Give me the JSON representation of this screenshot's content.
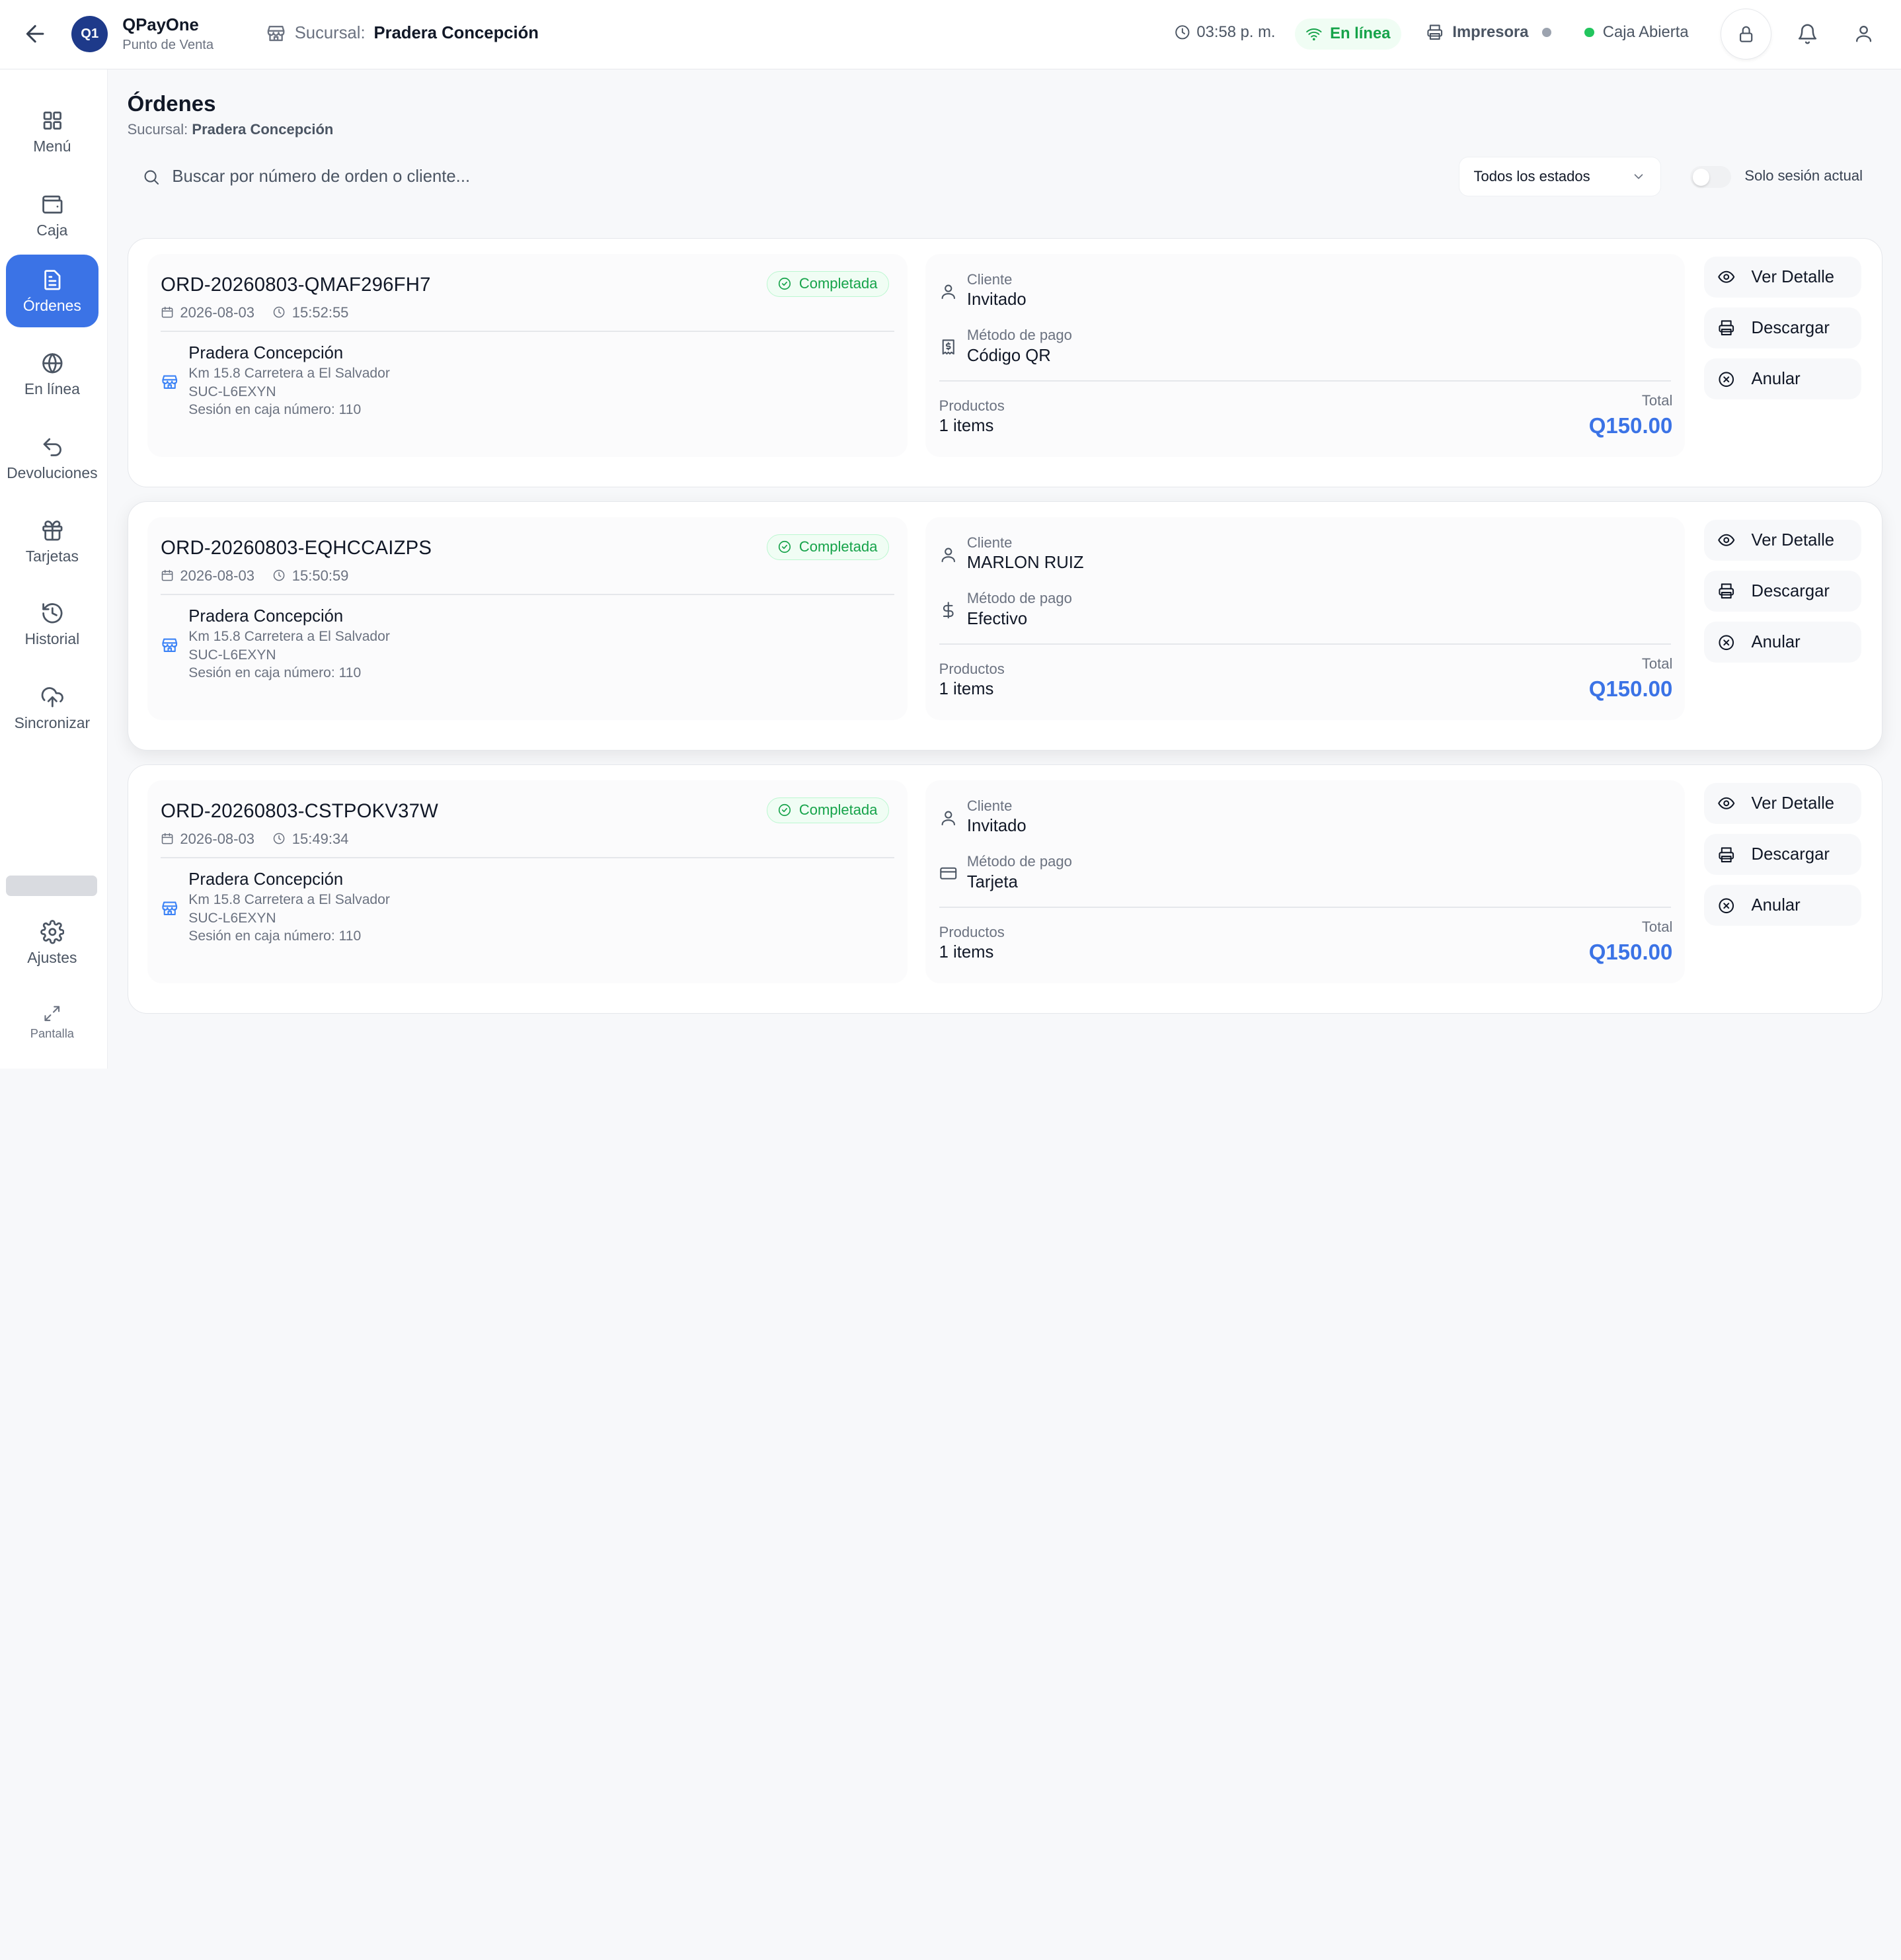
{
  "header": {
    "logo_text": "Q1",
    "app_name": "QPayOne",
    "app_subtitle": "Punto de Venta",
    "branch_label": "Sucursal:",
    "branch_name": "Pradera Concepción",
    "time": "03:58 p. m.",
    "online_label": "En línea",
    "printer_label": "Impresora",
    "register_label": "Caja Abierta"
  },
  "sidebar": {
    "items": [
      {
        "label": "Menú",
        "icon": "grid-icon"
      },
      {
        "label": "Caja",
        "icon": "wallet-icon"
      },
      {
        "label": "Órdenes",
        "icon": "receipt-icon"
      },
      {
        "label": "En línea",
        "icon": "globe-icon"
      },
      {
        "label": "Devoluciones",
        "icon": "undo-icon"
      },
      {
        "label": "Tarjetas",
        "icon": "gift-icon"
      },
      {
        "label": "Historial",
        "icon": "history-icon"
      },
      {
        "label": "Sincronizar",
        "icon": "cloud-upload-icon"
      }
    ],
    "settings_label": "Ajustes",
    "fullscreen_label": "Pantalla",
    "active_index": 2
  },
  "page": {
    "title": "Órdenes",
    "subtitle_label": "Sucursal:",
    "subtitle_value": "Pradera Concepción"
  },
  "filters": {
    "search_placeholder": "Buscar por número de orden o cliente...",
    "search_value": "",
    "status_selected": "Todos los estados",
    "session_toggle_label": "Solo sesión actual",
    "session_toggle_on": false
  },
  "labels": {
    "client": "Cliente",
    "payment": "Método de pago",
    "products": "Productos",
    "total": "Total",
    "view_detail": "Ver Detalle",
    "download": "Descargar",
    "cancel": "Anular"
  },
  "orders": [
    {
      "id": "ORD-20260803-QMAF296FH7",
      "status": "Completada",
      "date": "2026-08-03",
      "time": "15:52:55",
      "store_name": "Pradera Concepción",
      "store_address": "Km 15.8 Carretera a El Salvador",
      "store_code": "SUC-L6EXYN",
      "session": "Sesión en caja número: 110",
      "client": "Invitado",
      "payment_method": "Código QR",
      "payment_icon": "qr-receipt-icon",
      "products": "1 items",
      "total": "Q150.00"
    },
    {
      "id": "ORD-20260803-EQHCCAIZPS",
      "status": "Completada",
      "date": "2026-08-03",
      "time": "15:50:59",
      "store_name": "Pradera Concepción",
      "store_address": "Km 15.8 Carretera a El Salvador",
      "store_code": "SUC-L6EXYN",
      "session": "Sesión en caja número: 110",
      "client": "MARLON RUIZ",
      "payment_method": "Efectivo",
      "payment_icon": "dollar-icon",
      "products": "1 items",
      "total": "Q150.00"
    },
    {
      "id": "ORD-20260803-CSTPOKV37W",
      "status": "Completada",
      "date": "2026-08-03",
      "time": "15:49:34",
      "store_name": "Pradera Concepción",
      "store_address": "Km 15.8 Carretera a El Salvador",
      "store_code": "SUC-L6EXYN",
      "session": "Sesión en caja número: 110",
      "client": "Invitado",
      "payment_method": "Tarjeta",
      "payment_icon": "credit-card-icon",
      "products": "1 items",
      "total": "Q150.00"
    }
  ],
  "colors": {
    "accent": "#3b73e6",
    "success": "#16a34a",
    "logo_bg": "#1e3a8a"
  }
}
